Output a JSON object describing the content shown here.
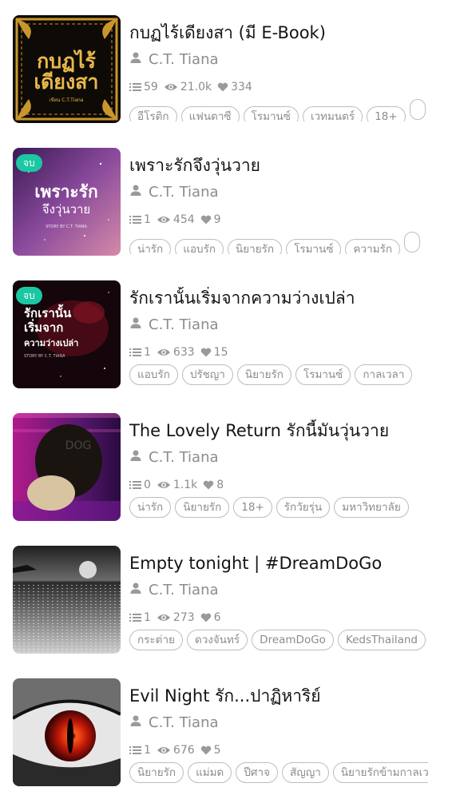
{
  "books": [
    {
      "title": "กบฏไร้เดียงสา (มี E-Book)",
      "author": "C.T. Tiana",
      "chapters": "59",
      "views": "21.0k",
      "likes": "334",
      "badge": "",
      "cover_text": [
        "กบฏไร้",
        "เดียงสา",
        "เขียน C.T.Tiana"
      ],
      "tags": [
        "อีโรติก",
        "แฟนตาซี",
        "โรมานซ์",
        "เวทมนตร์",
        "18+",
        ""
      ]
    },
    {
      "title": "เพราะรักจึงวุ่นวาย",
      "author": "C.T. Tiana",
      "chapters": "1",
      "views": "454",
      "likes": "9",
      "badge": "จบ",
      "cover_text": [
        "เพราะรัก",
        "จึงวุ่นวาย",
        "STORY BY C.T. TIANA"
      ],
      "tags": [
        "น่ารัก",
        "แอบรัก",
        "นิยายรัก",
        "โรมานซ์",
        "ความรัก",
        ""
      ]
    },
    {
      "title": "รักเรานั้นเริ่มจากความว่างเปล่า",
      "author": "C.T. Tiana",
      "chapters": "1",
      "views": "633",
      "likes": "15",
      "badge": "จบ",
      "cover_text": [
        "รักเรานั้น",
        "เริ่มจาก",
        "ความว่างเปล่า",
        "STORY BY C.T. TIANA"
      ],
      "tags": [
        "แอบรัก",
        "ปรัชญา",
        "นิยายรัก",
        "โรมานซ์",
        "กาลเวลา"
      ]
    },
    {
      "title": "The Lovely Return รักนี้มันวุ่นวาย",
      "author": "C.T. Tiana",
      "chapters": "0",
      "views": "1.1k",
      "likes": "8",
      "badge": "",
      "cover_text": [
        "DOG"
      ],
      "tags": [
        "น่ารัก",
        "นิยายรัก",
        "18+",
        "รักวัยรุ่น",
        "มหาวิทยาลัย"
      ]
    },
    {
      "title": "Empty tonight | #DreamDoGo",
      "author": "C.T. Tiana",
      "chapters": "1",
      "views": "273",
      "likes": "6",
      "badge": "",
      "cover_text": [],
      "tags": [
        "กระต่าย",
        "ดวงจันทร์",
        "DreamDoGo",
        "KedsThailand"
      ]
    },
    {
      "title": "Evil Night รัก...ปาฏิหาริย์",
      "author": "C.T. Tiana",
      "chapters": "1",
      "views": "676",
      "likes": "5",
      "badge": "",
      "cover_text": [],
      "tags": [
        "นิยายรัก",
        "แม่มด",
        "ปีศาจ",
        "สัญญา",
        "นิยายรักข้ามกาลเวลา"
      ]
    }
  ]
}
